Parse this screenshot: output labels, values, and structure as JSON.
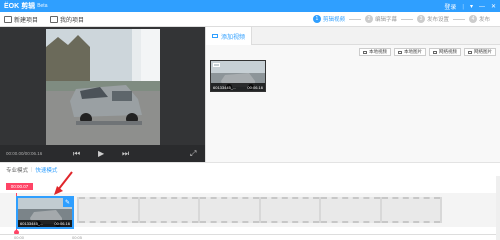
{
  "app": {
    "logo": "ЁOK",
    "title": "剪辑",
    "suffix": "Beta"
  },
  "window": {
    "login": "登录",
    "menu_icon": "dropdown-icon",
    "min_icon": "minimize-icon",
    "close_icon": "close-icon"
  },
  "toolbar": {
    "new_project": "新建项目",
    "my_projects": "我的项目"
  },
  "steps": [
    {
      "num": "1",
      "label": "剪辑视频"
    },
    {
      "num": "2",
      "label": "编辑字幕"
    },
    {
      "num": "3",
      "label": "发布设置"
    },
    {
      "num": "4",
      "label": "发布"
    }
  ],
  "preview": {
    "timecode": "00:00.00/00:06.16"
  },
  "media": {
    "tab_label": "添加视频",
    "actions": [
      "本地视频",
      "本地图片",
      "网络视频",
      "网络图片"
    ],
    "clip": {
      "name": "60133445_...",
      "duration": "00:06.16"
    }
  },
  "modes": {
    "pro": "专业模式",
    "separator": "|",
    "quick": "快速模式"
  },
  "timeline": {
    "head_time": "00:00.07",
    "clip": {
      "name": "60133445_...",
      "duration": "00:06.16"
    },
    "ruler": [
      "00:00",
      "00:05"
    ],
    "empty_slots": 6
  },
  "colors": {
    "accent": "#2f9fff",
    "playhead": "#ff4466",
    "arrow": "#e0262b"
  }
}
